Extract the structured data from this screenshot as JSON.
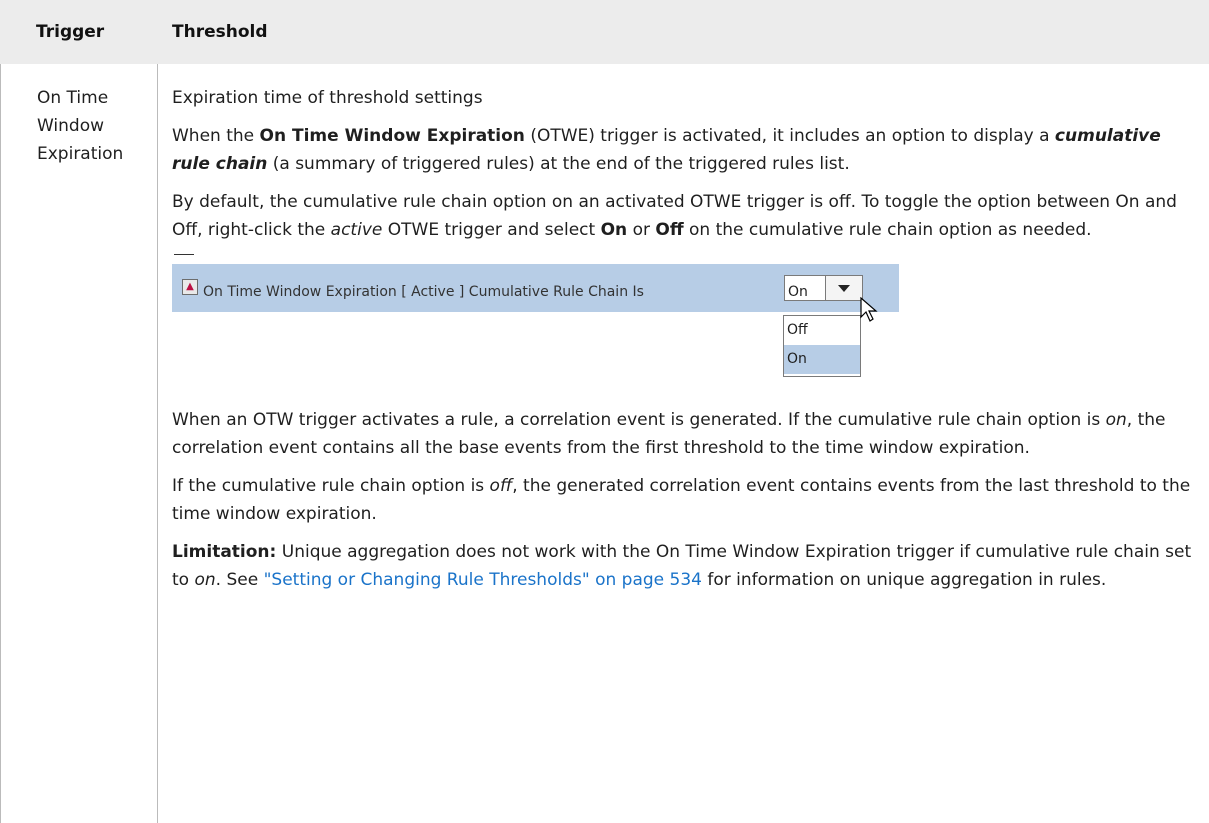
{
  "header": {
    "col1": "Trigger",
    "col2": "Threshold"
  },
  "row": {
    "trigger_lines": [
      "On Time",
      "Window",
      "Expiration"
    ],
    "p1": "Expiration time of threshold settings",
    "p2": {
      "a": "When the ",
      "b": "On Time Window Expiration",
      "c": " (OTWE) trigger is activated, it includes an option to display a ",
      "d": "cumulative rule chain",
      "e": " (a summary of triggered rules) at the end of the triggered rules list."
    },
    "p3": {
      "a": "By default, the cumulative rule chain option on an activated OTWE trigger is off. To toggle the option between On and Off, right-click the ",
      "b": "active",
      "c": " OTWE trigger and select ",
      "d": "On",
      "e": " or ",
      "f": "Off",
      "g": " on the cumulative rule chain option as needed."
    },
    "screenshot": {
      "bar_text": "On Time Window Expiration [ Active ] Cumulative Rule Chain Is",
      "combo_value": "On",
      "options": [
        "Off",
        "On"
      ],
      "selected_option": "On"
    },
    "p4": {
      "a": "When an OTW trigger activates a rule, a correlation event is generated. If the cumulative rule chain option is ",
      "b": "on",
      "c": ", the correlation event contains all the base events from the first threshold to the time window expiration."
    },
    "p5": {
      "a": "If the cumulative rule chain option is ",
      "b": "off",
      "c": ", the generated correlation event contains events from the last threshold to the time window expiration."
    },
    "p6": {
      "a": "Limitation:",
      "b": " Unique aggregation does not work with the On Time Window Expiration trigger if cumulative rule chain set to ",
      "c": "on",
      "d": ". See ",
      "link": "\"Setting or Changing Rule Thresholds\" on page 534",
      "e": " for information on unique aggregation in rules."
    }
  },
  "colors": {
    "header_bg": "#ececec",
    "link": "#1a73c9",
    "bar_bg": "#b7cde6"
  }
}
